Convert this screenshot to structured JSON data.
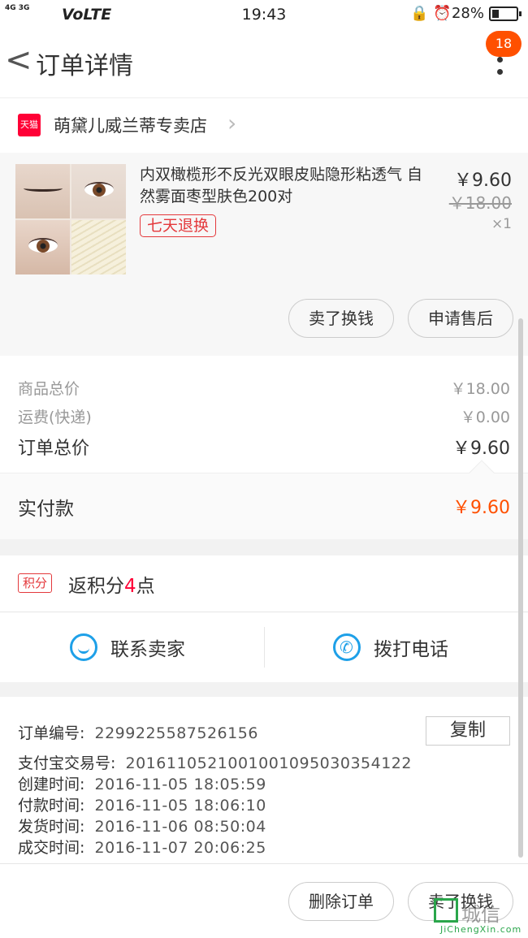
{
  "status_bar": {
    "network": "4G 3G",
    "carrier_label": "VoLTE",
    "time": "19:43",
    "battery": "28%"
  },
  "header": {
    "back_glyph": "<",
    "title": "订单详情",
    "badge_count": "18"
  },
  "shop": {
    "logo_text": "天猫",
    "name": "萌黛儿威兰蒂专卖店"
  },
  "product": {
    "title": "内双橄榄形不反光双眼皮贴隐形粘透气 自然雾面枣型肤色200对",
    "tag": "七天退换",
    "price": "￥9.60",
    "original_price": "￥18.00",
    "quantity": "×1",
    "buttons": [
      "卖了换钱",
      "申请售后"
    ]
  },
  "price_summary": {
    "goods_total_label": "商品总价",
    "goods_total_value": "￥18.00",
    "shipping_label": "运费(快递)",
    "shipping_value": "￥0.00",
    "order_total_label": "订单总价",
    "order_total_value": "￥9.60",
    "paid_label": "实付款",
    "paid_value": "￥9.60"
  },
  "points": {
    "badge": "积分",
    "prefix": "返积分",
    "number": "4",
    "suffix": "点"
  },
  "contact": {
    "seller_label": "联系卖家",
    "call_label": "拨打电话"
  },
  "order_info": {
    "order_no_label": "订单编号:",
    "order_no": "2299225587526156",
    "copy_label": "复制",
    "alipay_label": "支付宝交易号:",
    "alipay_no": "2016110521001001095030354122",
    "created_label": "创建时间:",
    "created": "2016-11-05 18:05:59",
    "paid_label": "付款时间:",
    "paid": "2016-11-05 18:06:10",
    "shipped_label": "发货时间:",
    "shipped": "2016-11-06 08:50:04",
    "closed_label": "成交时间:",
    "closed": "2016-11-07 20:06:25"
  },
  "bottom_bar": {
    "delete_label": "删除订单",
    "sell_label": "卖了换钱"
  },
  "watermark": {
    "cn": "城信",
    "en": "JiChengXin.com"
  },
  "colors": {
    "accent_orange": "#ff5000",
    "tmall_red": "#ff0036",
    "icon_blue": "#1ea0e8"
  }
}
